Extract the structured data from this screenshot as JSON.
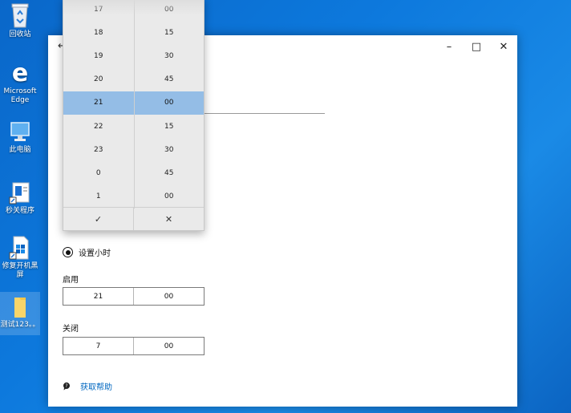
{
  "desktop": {
    "icons": [
      {
        "label": "回收站",
        "icon": "recycle-bin-icon"
      },
      {
        "label": "Microsoft Edge",
        "icon": "edge-icon"
      },
      {
        "label": "此电脑",
        "icon": "this-pc-icon"
      },
      {
        "label": "秒关程序",
        "icon": "app-shortcut-icon"
      },
      {
        "label": "修复开机黑屏",
        "icon": "repair-tool-icon"
      },
      {
        "label": "测试123。。",
        "icon": "folder-icon"
      }
    ]
  },
  "window": {
    "controls": {
      "minimize": "–",
      "maximize": "□",
      "close": "✕"
    },
    "back": "←",
    "radio_label": "设置小时",
    "start_label": "启用",
    "start_time": {
      "hour": "21",
      "minute": "00"
    },
    "end_label": "关闭",
    "end_time": {
      "hour": "7",
      "minute": "00"
    },
    "help_link": "获取帮助"
  },
  "picker": {
    "hours": [
      "17",
      "18",
      "19",
      "20",
      "21",
      "22",
      "23",
      "0",
      "1"
    ],
    "minutes": [
      "00",
      "15",
      "30",
      "45",
      "00",
      "15",
      "30",
      "45",
      "00"
    ],
    "selected_index": 4,
    "accept": "✓",
    "dismiss": "✕",
    "selection_color": "#94bde6"
  }
}
